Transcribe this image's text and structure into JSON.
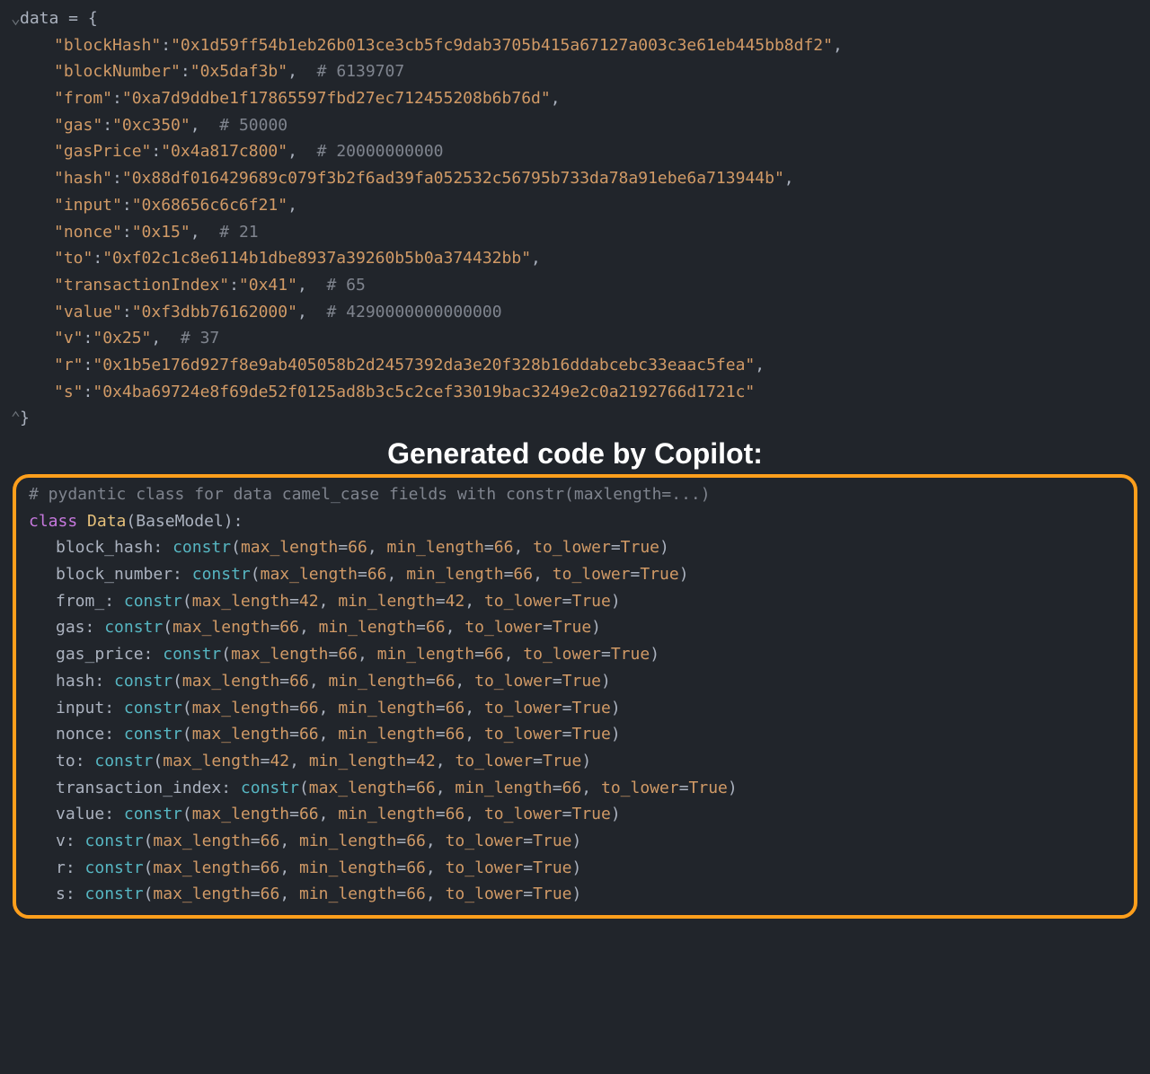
{
  "code_top": {
    "assign": "data = {",
    "entries": [
      {
        "key": "\"blockHash\"",
        "value": "\"0x1d59ff54b1eb26b013ce3cb5fc9dab3705b415a67127a003c3e61eb445bb8df2\"",
        "comment": ""
      },
      {
        "key": "\"blockNumber\"",
        "value": "\"0x5daf3b\"",
        "comment": "# 6139707"
      },
      {
        "key": "\"from\"",
        "value": "\"0xa7d9ddbe1f17865597fbd27ec712455208b6b76d\"",
        "comment": ""
      },
      {
        "key": "\"gas\"",
        "value": "\"0xc350\"",
        "comment": "# 50000"
      },
      {
        "key": "\"gasPrice\"",
        "value": "\"0x4a817c800\"",
        "comment": "# 20000000000"
      },
      {
        "key": "\"hash\"",
        "value": "\"0x88df016429689c079f3b2f6ad39fa052532c56795b733da78a91ebe6a713944b\"",
        "comment": ""
      },
      {
        "key": "\"input\"",
        "value": "\"0x68656c6c6f21\"",
        "comment": ""
      },
      {
        "key": "\"nonce\"",
        "value": "\"0x15\"",
        "comment": "# 21"
      },
      {
        "key": "\"to\"",
        "value": "\"0xf02c1c8e6114b1dbe8937a39260b5b0a374432bb\"",
        "comment": ""
      },
      {
        "key": "\"transactionIndex\"",
        "value": "\"0x41\"",
        "comment": "# 65"
      },
      {
        "key": "\"value\"",
        "value": "\"0xf3dbb76162000\"",
        "comment": "# 4290000000000000"
      },
      {
        "key": "\"v\"",
        "value": "\"0x25\"",
        "comment": "# 37"
      },
      {
        "key": "\"r\"",
        "value": "\"0x1b5e176d927f8e9ab405058b2d2457392da3e20f328b16ddabcebc33eaac5fea\"",
        "comment": ""
      },
      {
        "key": "\"s\"",
        "value": "\"0x4ba69724e8f69de52f0125ad8b3c5c2cef33019bac3249e2c0a2192766d1721c\"",
        "comment": ""
      }
    ],
    "close": "}"
  },
  "heading": "Generated code by Copilot:",
  "code_bottom": {
    "comment": "# pydantic class for data camel_case fields with constr(maxlength=...)",
    "classline_kw": "class",
    "classline_name": "Data",
    "classline_base": "BaseModel",
    "fields": [
      {
        "name": "block_hash",
        "maxlen": "66",
        "minlen": "66"
      },
      {
        "name": "block_number",
        "maxlen": "66",
        "minlen": "66"
      },
      {
        "name": "from_",
        "maxlen": "42",
        "minlen": "42"
      },
      {
        "name": "gas",
        "maxlen": "66",
        "minlen": "66"
      },
      {
        "name": "gas_price",
        "maxlen": "66",
        "minlen": "66"
      },
      {
        "name": "hash",
        "maxlen": "66",
        "minlen": "66"
      },
      {
        "name": "input",
        "maxlen": "66",
        "minlen": "66"
      },
      {
        "name": "nonce",
        "maxlen": "66",
        "minlen": "66"
      },
      {
        "name": "to",
        "maxlen": "42",
        "minlen": "42"
      },
      {
        "name": "transaction_index",
        "maxlen": "66",
        "minlen": "66"
      },
      {
        "name": "value",
        "maxlen": "66",
        "minlen": "66"
      },
      {
        "name": "v",
        "maxlen": "66",
        "minlen": "66"
      },
      {
        "name": "r",
        "maxlen": "66",
        "minlen": "66"
      },
      {
        "name": "s",
        "maxlen": "66",
        "minlen": "66"
      }
    ],
    "constr": "constr",
    "max_label": "max_length",
    "min_label": "min_length",
    "lower_label": "to_lower",
    "true": "True"
  }
}
